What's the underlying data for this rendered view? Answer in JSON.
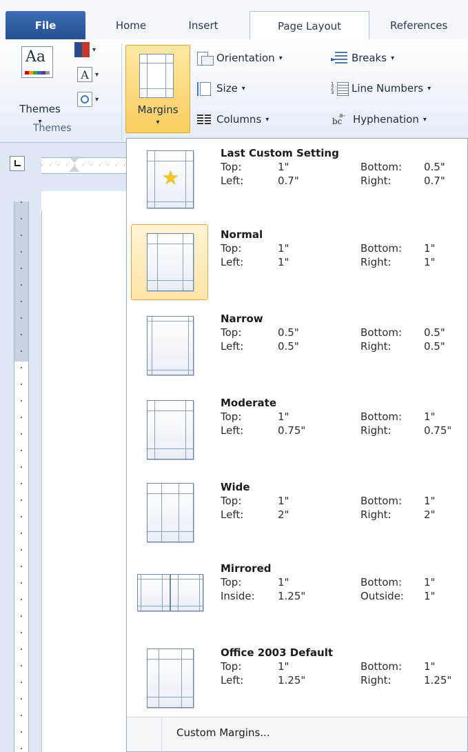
{
  "tabs": [
    {
      "label": "File"
    },
    {
      "label": "Home"
    },
    {
      "label": "Insert"
    },
    {
      "label": "Page Layout"
    },
    {
      "label": "References"
    }
  ],
  "ribbon": {
    "themes_label": "Themes",
    "themes_glyph": "Aa",
    "font_glyph": "A",
    "group_themes": "Themes",
    "margins_label": "Margins",
    "orientation": "Orientation",
    "size": "Size",
    "columns": "Columns",
    "breaks": "Breaks",
    "line_numbers": "Line Numbers",
    "hyphenation": "Hyphenation",
    "dropdown_glyph": "▾"
  },
  "margins_menu": {
    "items": [
      {
        "name": "Last Custom Setting",
        "k1": "Top:",
        "v1": "1\"",
        "k2": "Bottom:",
        "v2": "0.5\"",
        "k3": "Left:",
        "v3": "0.7\"",
        "k4": "Right:",
        "v4": "0.7\""
      },
      {
        "name": "Normal",
        "k1": "Top:",
        "v1": "1\"",
        "k2": "Bottom:",
        "v2": "1\"",
        "k3": "Left:",
        "v3": "1\"",
        "k4": "Right:",
        "v4": "1\""
      },
      {
        "name": "Narrow",
        "k1": "Top:",
        "v1": "0.5\"",
        "k2": "Bottom:",
        "v2": "0.5\"",
        "k3": "Left:",
        "v3": "0.5\"",
        "k4": "Right:",
        "v4": "0.5\""
      },
      {
        "name": "Moderate",
        "k1": "Top:",
        "v1": "1\"",
        "k2": "Bottom:",
        "v2": "1\"",
        "k3": "Left:",
        "v3": "0.75\"",
        "k4": "Right:",
        "v4": "0.75\""
      },
      {
        "name": "Wide",
        "k1": "Top:",
        "v1": "1\"",
        "k2": "Bottom:",
        "v2": "1\"",
        "k3": "Left:",
        "v3": "2\"",
        "k4": "Right:",
        "v4": "2\""
      },
      {
        "name": "Mirrored",
        "k1": "Top:",
        "v1": "1\"",
        "k2": "Bottom:",
        "v2": "1\"",
        "k3": "Inside:",
        "v3": "1.25\"",
        "k4": "Outside:",
        "v4": "1\""
      },
      {
        "name": "Office 2003 Default",
        "k1": "Top:",
        "v1": "1\"",
        "k2": "Bottom:",
        "v2": "1\"",
        "k3": "Left:",
        "v3": "1.25\"",
        "k4": "Right:",
        "v4": "1.25\""
      }
    ],
    "selected": "Normal",
    "custom_margins": "Custom Margins..."
  },
  "colors": {
    "file_tab": "#2b579a",
    "highlight": "#f9cd5e",
    "star": "#f2c523"
  }
}
